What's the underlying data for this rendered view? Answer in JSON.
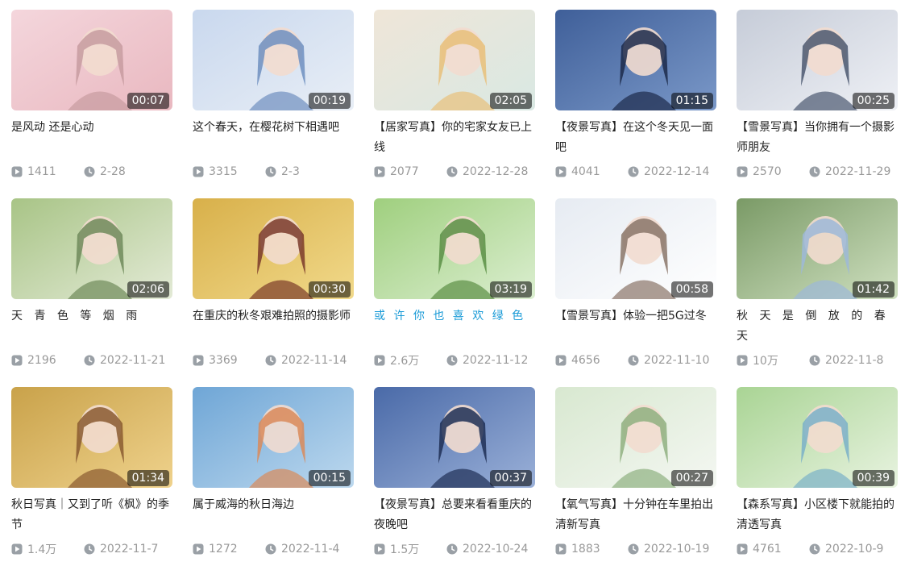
{
  "colors": {
    "icon": "#9aa0a6",
    "meta_text": "#999999",
    "title_text": "#222222",
    "link": "#1a9bd7"
  },
  "icons": {
    "views": "play-icon",
    "date": "clock-icon"
  },
  "videos": [
    {
      "title": "是风动 还是心动",
      "duration": "00:07",
      "views": "1411",
      "date": "2-28",
      "thumb": [
        "#f4d6dc",
        "#e9b8c0",
        "#c79ba0"
      ]
    },
    {
      "title": "这个春天，在樱花树下相遇吧",
      "duration": "00:19",
      "views": "3315",
      "date": "2-3",
      "thumb": [
        "#c9d8ee",
        "#e8eef6",
        "#6f8fbf"
      ]
    },
    {
      "title": "【居家写真】你的宅家女友已上线",
      "duration": "02:05",
      "views": "2077",
      "date": "2022-12-28",
      "thumb": [
        "#efe6d8",
        "#d9e8e3",
        "#e8c07a"
      ]
    },
    {
      "title": "【夜景写真】在这个冬天见一面吧",
      "duration": "01:15",
      "views": "4041",
      "date": "2022-12-14",
      "thumb": [
        "#3f5f99",
        "#7a98c8",
        "#1c2a4a"
      ]
    },
    {
      "title": "【雪景写真】当你拥有一个摄影师朋友",
      "duration": "00:25",
      "views": "2570",
      "date": "2022-11-29",
      "thumb": [
        "#c6ccd8",
        "#eef0f5",
        "#4b5870"
      ]
    },
    {
      "title": "天 青 色 等 烟 雨",
      "duration": "02:06",
      "views": "2196",
      "date": "2022-11-21",
      "thumb": [
        "#a8c486",
        "#e3ead6",
        "#6f8a5a"
      ]
    },
    {
      "title": "在重庆的秋冬艰难拍照的摄影师",
      "duration": "00:30",
      "views": "3369",
      "date": "2022-11-14",
      "thumb": [
        "#d8b04a",
        "#f1d98a",
        "#7a3a2a"
      ]
    },
    {
      "title": "或 许 你 也 喜 欢 绿 色",
      "duration": "03:19",
      "views": "2.6万",
      "date": "2022-11-12",
      "thumb": [
        "#9fcf7e",
        "#dbeed0",
        "#5b8f45"
      ]
    },
    {
      "title": "【雪景写真】体验一把5G过冬",
      "duration": "00:58",
      "views": "4656",
      "date": "2022-11-10",
      "thumb": [
        "#e6ebf2",
        "#ffffff",
        "#8a7568"
      ]
    },
    {
      "title": "秋 天 是 倒 放 的 春 天",
      "duration": "01:42",
      "views": "10万",
      "date": "2022-11-8",
      "thumb": [
        "#7a9a66",
        "#cfe0c0",
        "#9db8d8"
      ]
    },
    {
      "title": "秋日写真｜又到了听《枫》的季节",
      "duration": "01:34",
      "views": "1.4万",
      "date": "2022-11-7",
      "thumb": [
        "#c9a24a",
        "#efd28c",
        "#8a5a30"
      ]
    },
    {
      "title": "属于威海的秋日海边",
      "duration": "00:15",
      "views": "1272",
      "date": "2022-11-4",
      "thumb": [
        "#6fa6d6",
        "#bcd8ee",
        "#d98a5a"
      ]
    },
    {
      "title": "【夜景写真】总要来看看重庆的夜晚吧",
      "duration": "00:37",
      "views": "1.5万",
      "date": "2022-10-24",
      "thumb": [
        "#4a6aa8",
        "#9ab0d8",
        "#1f2f55"
      ]
    },
    {
      "title": "【氧气写真】十分钟在车里拍出清新写真",
      "duration": "00:27",
      "views": "1883",
      "date": "2022-10-19",
      "thumb": [
        "#d8e8d0",
        "#f4f7f2",
        "#8fb080"
      ]
    },
    {
      "title": "【森系写真】小区楼下就能拍的清透写真",
      "duration": "00:39",
      "views": "4761",
      "date": "2022-10-9",
      "thumb": [
        "#a9d494",
        "#e8f3e0",
        "#7ab0c8"
      ]
    }
  ]
}
